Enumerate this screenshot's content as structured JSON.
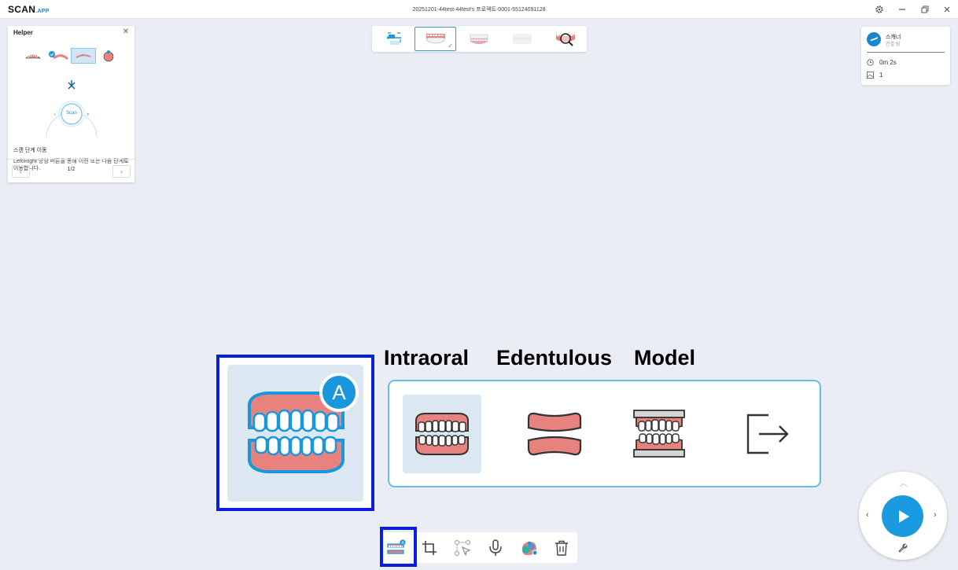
{
  "app": {
    "logo_main": "SCAN",
    "logo_suffix": ".APP",
    "document_title": "20251201-44test-44test's 프로젝트-0001-55124091128"
  },
  "helper": {
    "title": "Helper",
    "dial_label": "Scan",
    "heading": "스캔 단계 이동",
    "description": "Left/Right 방향 버튼을 통해 이전 또는 다음 단계로 이동합니다.",
    "page": "1/2"
  },
  "scanner": {
    "name": "스캐너",
    "status": "연결 됨",
    "time": "0m 2s",
    "count": "1"
  },
  "modes": {
    "intraoral_label": "Intraoral",
    "edentulous_label": "Edentulous",
    "model_label": "Model",
    "badge": "A"
  },
  "colors": {
    "accent": "#1a9ae0",
    "highlight_box": "#0a1ee0",
    "gum": "#e8827e",
    "outline": "#1a97dc"
  }
}
